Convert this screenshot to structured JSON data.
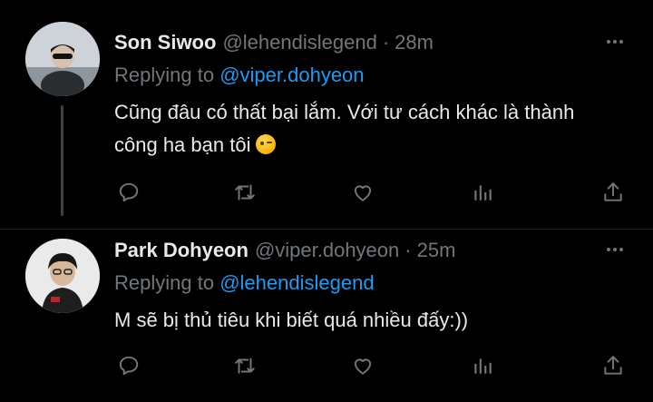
{
  "tweets": [
    {
      "author_name": "Son Siwoo",
      "handle": "@lehendislegend",
      "separator": "·",
      "time": "28m",
      "replying_prefix": "Replying to",
      "replying_to": "@viper.dohyeon",
      "text": "Cũng đâu có thất bại lắm. Với tư cách khác là thành công ha bạn tôi",
      "emoji": "winking-face"
    },
    {
      "author_name": "Park Dohyeon",
      "handle": "@viper.dohyeon",
      "separator": "·",
      "time": "25m",
      "replying_prefix": "Replying to",
      "replying_to": "@lehendislegend",
      "text": "M sẽ bị thủ tiêu khi biết quá nhiều đấy:))"
    }
  ],
  "icons": {
    "reply": "reply-icon",
    "retweet": "retweet-icon",
    "like": "like-icon",
    "analytics": "analytics-icon",
    "share": "share-icon",
    "more": "more-icon"
  },
  "colors": {
    "background": "#000000",
    "primary_text": "#e7e9ea",
    "secondary_text": "#71767b",
    "link": "#1d9bf0"
  }
}
